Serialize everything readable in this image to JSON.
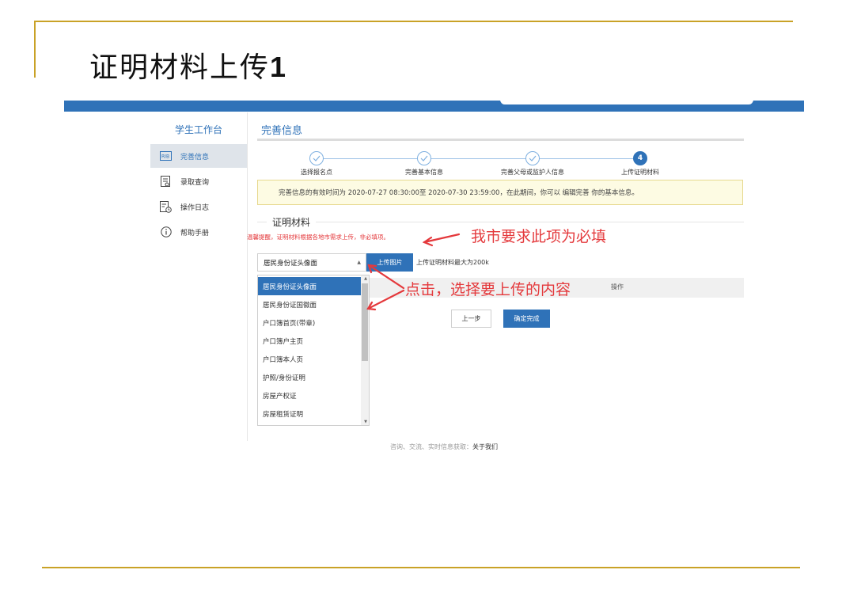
{
  "slide": {
    "title_text": "证明材料上传",
    "title_number": "1"
  },
  "sidebar": {
    "title": "学生工作台",
    "items": [
      {
        "label": "完善信息",
        "icon": "id-card-icon",
        "active": true
      },
      {
        "label": "录取查询",
        "icon": "document-search-icon",
        "active": false
      },
      {
        "label": "操作日志",
        "icon": "log-clock-icon",
        "active": false
      },
      {
        "label": "帮助手册",
        "icon": "info-circle-icon",
        "active": false
      }
    ]
  },
  "main": {
    "header": "完善信息",
    "steps": [
      {
        "label": "选择报名点",
        "state": "done"
      },
      {
        "label": "完善基本信息",
        "state": "done"
      },
      {
        "label": "完善父母或监护人信息",
        "state": "done"
      },
      {
        "label": "上传证明材料",
        "state": "current",
        "number": "4"
      }
    ],
    "notice": "完善信息的有效时间为 2020-07-27 08:30:00至 2020-07-30 23:59:00，在此期间，你可以 编辑完善 你的基本信息。",
    "section_title": "证明材料",
    "hint": "温馨提醒，证明材料根据各地市需求上传，非必填项。",
    "select_value": "居民身份证头像面",
    "upload_button": "上传图片",
    "upload_note": "上传证明材料最大为200k",
    "table_op_header": "操作",
    "dropdown_options": [
      "居民身份证头像面",
      "居民身份证国徽面",
      "户口簿首页(带章)",
      "户口簿户主页",
      "户口簿本人页",
      "护照/身份证明",
      "房屋产权证",
      "房屋租赁证明"
    ],
    "prev_button": "上一步",
    "finish_button": "确定完成"
  },
  "footer": {
    "text": "咨询、交流、实时信息获取：",
    "link": "关于我们"
  },
  "annotations": {
    "required_note": "我市要求此项为必填",
    "click_note": "点击，选择要上传的内容"
  },
  "colors": {
    "brand_blue": "#2f72b8",
    "gold_rule": "#c9a227",
    "annotation_red": "#e4393c",
    "notice_bg": "#fdfbe3"
  }
}
